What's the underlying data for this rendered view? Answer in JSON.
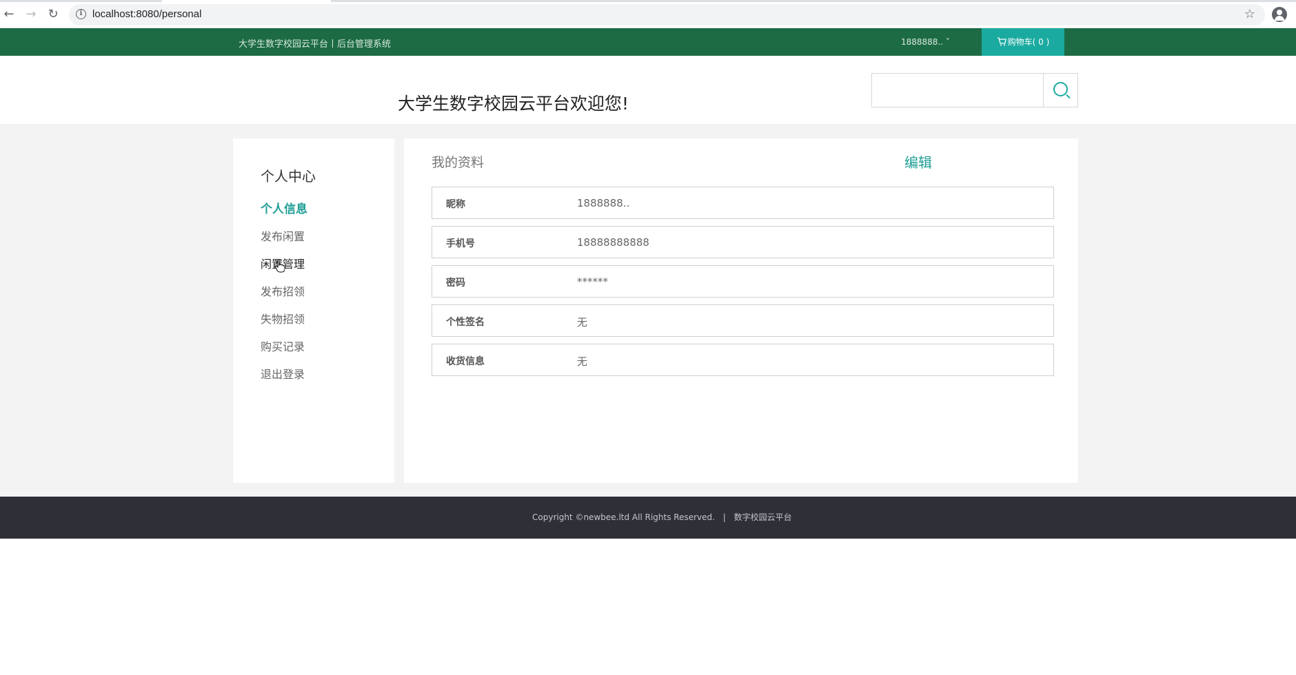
{
  "browser": {
    "url": "localhost:8080/personal"
  },
  "topbar": {
    "brand": "大学生数字校园云平台丨后台管理系统",
    "user": "1888888.. ˅",
    "cart": "购物车( 0 )",
    "cart_icon": "cart-icon"
  },
  "header": {
    "welcome": "大学生数字校园云平台欢迎您!",
    "search_value": "",
    "search_icon": "search-icon"
  },
  "sidebar": {
    "title": "个人中心",
    "items": [
      {
        "label": "个人信息",
        "active": true
      },
      {
        "label": "发布闲置",
        "active": false
      },
      {
        "label": "闲置管理",
        "active": false
      },
      {
        "label": "发布招领",
        "active": false
      },
      {
        "label": "失物招领",
        "active": false
      },
      {
        "label": "购买记录",
        "active": false
      },
      {
        "label": "退出登录",
        "active": false
      }
    ]
  },
  "profile": {
    "heading": "我的资料",
    "edit_label": "编辑",
    "fields": [
      {
        "label": "昵称",
        "value": "1888888.."
      },
      {
        "label": "手机号",
        "value": "18888888888"
      },
      {
        "label": "密码",
        "value": "******"
      },
      {
        "label": "个性签名",
        "value": "无"
      },
      {
        "label": "收货信息",
        "value": "无"
      }
    ]
  },
  "footer": {
    "copyright": "Copyright ©newbee.ltd All Rights Reserved.",
    "separator": "|",
    "platform": "数字校园云平台"
  },
  "colors": {
    "topbar_bg": "#1c6b44",
    "accent": "#1baaa0",
    "footer_bg": "#2f2f38"
  }
}
